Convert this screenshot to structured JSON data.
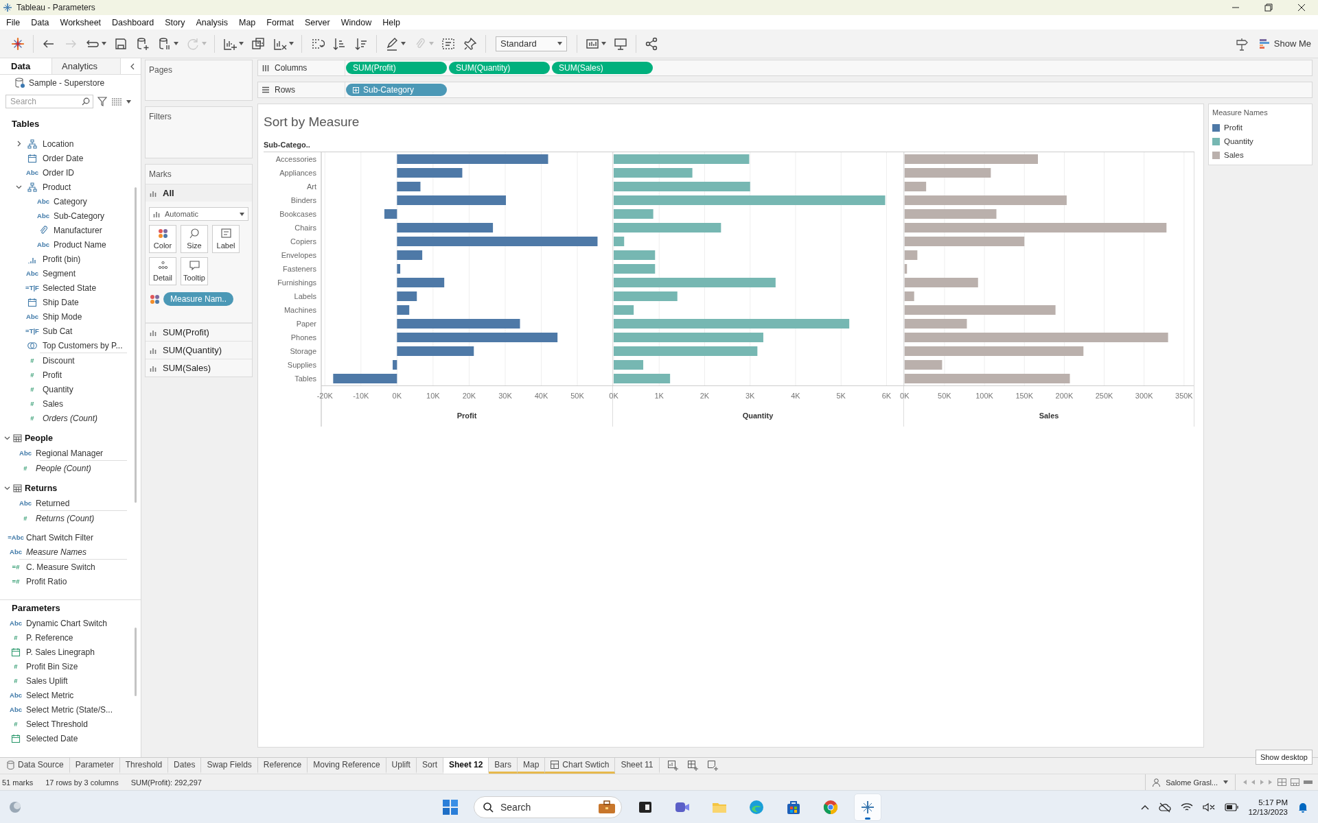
{
  "window": {
    "title": "Tableau - Parameters"
  },
  "menu": [
    "File",
    "Data",
    "Worksheet",
    "Dashboard",
    "Story",
    "Analysis",
    "Map",
    "Format",
    "Server",
    "Window",
    "Help"
  ],
  "toolbar": {
    "buttons": [
      {
        "kind": "logo",
        "disabled": false
      },
      {
        "kind": "undo",
        "disabled": false
      },
      {
        "kind": "redo",
        "disabled": true
      },
      {
        "kind": "replay",
        "disabled": false
      },
      {
        "kind": "save",
        "disabled": false
      },
      {
        "kind": "new-source",
        "disabled": false
      },
      {
        "kind": "pause",
        "disabled": false
      },
      {
        "kind": "refresh",
        "disabled": true
      },
      {
        "kind": "new-sheet",
        "disabled": false
      },
      {
        "kind": "duplicate",
        "disabled": false
      },
      {
        "kind": "clear",
        "disabled": false
      },
      {
        "kind": "swap",
        "disabled": false
      },
      {
        "kind": "sort-asc",
        "disabled": false
      },
      {
        "kind": "sort-desc",
        "disabled": false
      },
      {
        "kind": "highlight",
        "disabled": false
      },
      {
        "kind": "group",
        "disabled": true
      },
      {
        "kind": "labels",
        "disabled": false
      },
      {
        "kind": "pin",
        "disabled": false
      },
      {
        "kind": "fit",
        "value": "Standard"
      },
      {
        "kind": "cards",
        "disabled": false
      },
      {
        "kind": "present",
        "disabled": false
      },
      {
        "kind": "share",
        "disabled": false
      }
    ],
    "show_me": "Show Me"
  },
  "data_pane": {
    "tabs": [
      {
        "label": "Data",
        "selected": true
      },
      {
        "label": "Analytics",
        "selected": false
      }
    ],
    "datasource": "Sample - Superstore",
    "search": {
      "placeholder": "Search"
    },
    "tables_heading": "Tables",
    "sections": [
      {
        "kind": "fields",
        "groups": [
          [
            {
              "label": "Location",
              "kind": "hierarchy",
              "expanded": false
            },
            {
              "label": "Order Date",
              "kind": "date"
            },
            {
              "label": "Order ID",
              "kind": "string",
              "glyph": "Abc"
            },
            {
              "label": "Product",
              "kind": "hierarchy",
              "expanded": true,
              "children": [
                {
                  "label": "Category",
                  "kind": "string",
                  "glyph": "Abc"
                },
                {
                  "label": "Sub-Category",
                  "kind": "string",
                  "glyph": "Abc"
                },
                {
                  "label": "Manufacturer",
                  "kind": "group"
                },
                {
                  "label": "Product Name",
                  "kind": "string",
                  "glyph": "Abc"
                }
              ]
            },
            {
              "label": "Profit (bin)",
              "kind": "bin"
            },
            {
              "label": "Segment",
              "kind": "string",
              "glyph": "Abc"
            },
            {
              "label": "Selected State",
              "kind": "boolean",
              "glyph": "=T|F"
            },
            {
              "label": "Ship Date",
              "kind": "date"
            },
            {
              "label": "Ship Mode",
              "kind": "string",
              "glyph": "Abc"
            },
            {
              "label": "Sub Cat",
              "kind": "boolean",
              "glyph": "=T|F"
            },
            {
              "label": "Top Customers by P...",
              "kind": "set"
            }
          ],
          [
            {
              "label": "Discount",
              "kind": "measure",
              "glyph": "#"
            },
            {
              "label": "Profit",
              "kind": "measure",
              "glyph": "#"
            },
            {
              "label": "Quantity",
              "kind": "measure",
              "glyph": "#"
            },
            {
              "label": "Sales",
              "kind": "measure",
              "glyph": "#"
            },
            {
              "label": "Orders (Count)",
              "kind": "measure",
              "glyph": "#",
              "italic": true
            }
          ]
        ]
      },
      {
        "kind": "table",
        "name": "People",
        "expanded": true,
        "groups": [
          [
            {
              "label": "Regional Manager",
              "kind": "string",
              "glyph": "Abc"
            }
          ],
          [
            {
              "label": "People (Count)",
              "kind": "measure",
              "glyph": "#",
              "italic": true
            }
          ]
        ]
      },
      {
        "kind": "table",
        "name": "Returns",
        "expanded": true,
        "groups": [
          [
            {
              "label": "Returned",
              "kind": "string",
              "glyph": "Abc"
            }
          ],
          [
            {
              "label": "Returns (Count)",
              "kind": "measure",
              "glyph": "#",
              "italic": true
            }
          ]
        ]
      },
      {
        "kind": "loose",
        "groups": [
          [
            {
              "label": "Chart Switch Filter",
              "kind": "calc-string",
              "glyph": "=Abc"
            },
            {
              "label": "Measure Names",
              "kind": "string",
              "glyph": "Abc",
              "italic": true
            }
          ],
          [
            {
              "label": "C. Measure Switch",
              "kind": "calc-measure",
              "glyph": "=#"
            },
            {
              "label": "Profit Ratio",
              "kind": "calc-measure",
              "glyph": "=#"
            }
          ]
        ]
      }
    ],
    "parameters_heading": "Parameters",
    "parameters": [
      {
        "label": "Dynamic Chart Switch",
        "kind": "string",
        "glyph": "Abc"
      },
      {
        "label": "P. Reference",
        "kind": "measure",
        "glyph": "#"
      },
      {
        "label": "P. Sales Linegraph",
        "kind": "date"
      },
      {
        "label": "Profit Bin Size",
        "kind": "measure",
        "glyph": "#"
      },
      {
        "label": "Sales Uplift",
        "kind": "measure",
        "glyph": "#"
      },
      {
        "label": "Select Metric",
        "kind": "string",
        "glyph": "Abc"
      },
      {
        "label": "Select Metric (State/S...",
        "kind": "string",
        "glyph": "Abc"
      },
      {
        "label": "Select Threshold",
        "kind": "measure",
        "glyph": "#"
      },
      {
        "label": "Selected Date",
        "kind": "date"
      }
    ]
  },
  "cards": {
    "pages": "Pages",
    "filters": "Filters",
    "marks": {
      "title": "Marks",
      "tabs": [
        {
          "label": "All",
          "selected": true
        },
        {
          "label": "SUM(Profit)",
          "selected": false
        },
        {
          "label": "SUM(Quantity)",
          "selected": false
        },
        {
          "label": "SUM(Sales)",
          "selected": false
        }
      ],
      "mark_type": "Automatic",
      "buttons": [
        {
          "kind": "color",
          "label": "Color"
        },
        {
          "kind": "size",
          "label": "Size"
        },
        {
          "kind": "label",
          "label": "Label"
        },
        {
          "kind": "detail",
          "label": "Detail"
        },
        {
          "kind": "tooltip",
          "label": "Tooltip"
        }
      ],
      "pills": [
        {
          "kind": "color",
          "label": "Measure Nam.."
        }
      ]
    }
  },
  "shelves": [
    {
      "label": "Columns",
      "kind": "columns",
      "pills": [
        {
          "label": "SUM(Profit)",
          "kind": "measure"
        },
        {
          "label": "SUM(Quantity)",
          "kind": "measure"
        },
        {
          "label": "SUM(Sales)",
          "kind": "measure"
        }
      ]
    },
    {
      "label": "Rows",
      "kind": "rows",
      "pills": [
        {
          "label": "Sub-Category",
          "kind": "dimension"
        }
      ]
    }
  ],
  "viz": {
    "title": "Sort by Measure",
    "panes": [
      {
        "chart_data": {
          "type": "bar",
          "orientation": "horizontal",
          "xlabel": "Profit",
          "ylabel": "Sub-Catego..",
          "categories": [
            "Accessories",
            "Appliances",
            "Art",
            "Binders",
            "Bookcases",
            "Chairs",
            "Copiers",
            "Envelopes",
            "Fasteners",
            "Furnishings",
            "Labels",
            "Machines",
            "Paper",
            "Phones",
            "Storage",
            "Supplies",
            "Tables"
          ],
          "series": [
            {
              "color": "#4e79a7",
              "values": [
                41900,
                18100,
                6500,
                30200,
                -3500,
                26600,
                55600,
                7000,
                900,
                13100,
                5500,
                3400,
                34100,
                44500,
                21300,
                -1200,
                -17700
              ]
            }
          ],
          "grid": true,
          "xlim": [
            -21000,
            59700
          ],
          "xticks": [
            {
              "value": -20000,
              "label": "-20K"
            },
            {
              "value": -10000,
              "label": "-10K"
            },
            {
              "value": 0,
              "label": "0K"
            },
            {
              "value": 10000,
              "label": "10K"
            },
            {
              "value": 20000,
              "label": "20K"
            },
            {
              "value": 30000,
              "label": "30K"
            },
            {
              "value": 40000,
              "label": "40K"
            },
            {
              "value": 50000,
              "label": "50K"
            }
          ]
        }
      },
      {
        "chart_data": {
          "type": "bar",
          "orientation": "horizontal",
          "xlabel": "Quantity",
          "series": [
            {
              "color": "#76b7b2",
              "values": [
                2980,
                1730,
                3000,
                5970,
                870,
                2360,
                230,
                910,
                910,
                3560,
                1400,
                440,
                5180,
                3290,
                3160,
                650,
                1240
              ]
            }
          ],
          "grid": true,
          "xlim": [
            -30,
            6370
          ],
          "xticks": [
            {
              "value": 0,
              "label": "0K"
            },
            {
              "value": 1000,
              "label": "1K"
            },
            {
              "value": 2000,
              "label": "2K"
            },
            {
              "value": 3000,
              "label": "3K"
            },
            {
              "value": 4000,
              "label": "4K"
            },
            {
              "value": 5000,
              "label": "5K"
            },
            {
              "value": 6000,
              "label": "6K"
            }
          ]
        }
      },
      {
        "chart_data": {
          "type": "bar",
          "orientation": "horizontal",
          "xlabel": "Sales",
          "series": [
            {
              "color": "#bab0ac",
              "values": [
                167000,
                108000,
                27000,
                203000,
                115000,
                328000,
                150000,
                16000,
                3000,
                92000,
                12000,
                189000,
                78000,
                330000,
                224000,
                47000,
                207000
              ]
            }
          ],
          "grid": true,
          "xlim": [
            -1500,
            363000
          ],
          "xticks": [
            {
              "value": 0,
              "label": "0K"
            },
            {
              "value": 50000,
              "label": "50K"
            },
            {
              "value": 100000,
              "label": "100K"
            },
            {
              "value": 150000,
              "label": "150K"
            },
            {
              "value": 200000,
              "label": "200K"
            },
            {
              "value": 250000,
              "label": "250K"
            },
            {
              "value": 300000,
              "label": "300K"
            },
            {
              "value": 350000,
              "label": "350K"
            }
          ]
        }
      }
    ]
  },
  "legend": {
    "title": "Measure Names",
    "items": [
      {
        "label": "Profit",
        "color": "#4e79a7"
      },
      {
        "label": "Quantity",
        "color": "#76b7b2"
      },
      {
        "label": "Sales",
        "color": "#bab0ac"
      }
    ]
  },
  "sheet_tabs": [
    {
      "label": "Data Source",
      "kind": "datasource",
      "selected": false,
      "used": false
    },
    {
      "label": "Parameter",
      "kind": "sheet",
      "selected": false,
      "used": false
    },
    {
      "label": "Threshold",
      "kind": "sheet",
      "selected": false,
      "used": false
    },
    {
      "label": "Dates",
      "kind": "sheet",
      "selected": false,
      "used": false
    },
    {
      "label": "Swap Fields",
      "kind": "sheet",
      "selected": false,
      "used": false
    },
    {
      "label": "Reference",
      "kind": "sheet",
      "selected": false,
      "used": false
    },
    {
      "label": "Moving Reference",
      "kind": "sheet",
      "selected": false,
      "used": false
    },
    {
      "label": "Uplift",
      "kind": "sheet",
      "selected": false,
      "used": false
    },
    {
      "label": "Sort",
      "kind": "sheet",
      "selected": false,
      "used": false
    },
    {
      "label": "Sheet 12",
      "kind": "sheet",
      "selected": true,
      "used": false
    },
    {
      "label": "Bars",
      "kind": "sheet",
      "selected": false,
      "used": true
    },
    {
      "label": "Map",
      "kind": "sheet",
      "selected": false,
      "used": true
    },
    {
      "label": "Chart Swtich",
      "kind": "dashboard",
      "selected": false,
      "used": true
    },
    {
      "label": "Sheet 11",
      "kind": "sheet",
      "selected": false,
      "used": false
    }
  ],
  "status_bar": {
    "marks": "51 marks",
    "size": "17 rows by 3 columns",
    "summary": "SUM(Profit): 292,297",
    "user": "Salome Grasl..."
  },
  "taskbar": {
    "apps": [
      {
        "kind": "start",
        "active": false
      },
      {
        "kind": "search",
        "placeholder": "Search",
        "active": false
      },
      {
        "kind": "window",
        "active": false
      },
      {
        "kind": "video",
        "active": false
      },
      {
        "kind": "folder",
        "active": false
      },
      {
        "kind": "edge",
        "active": false
      },
      {
        "kind": "store",
        "active": false
      },
      {
        "kind": "chrome",
        "active": false
      },
      {
        "kind": "tableau",
        "active": true
      }
    ],
    "time": "5:17 PM",
    "date": "12/13/2023",
    "tooltip": "Show desktop"
  }
}
